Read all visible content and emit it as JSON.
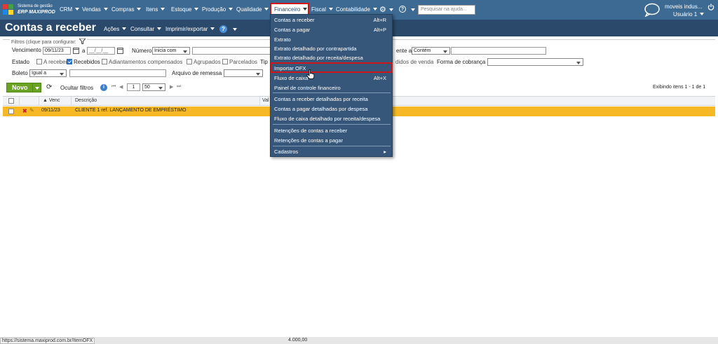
{
  "logo": {
    "line1": "Sistema de gestão",
    "line2": "ERP MAXIPROD"
  },
  "nav": {
    "items": [
      "CRM",
      "Vendas",
      "Compras",
      "Itens",
      "Estoque",
      "Produção",
      "Qualidade",
      "Financeiro",
      "Fiscal",
      "Contabilidade"
    ],
    "search_placeholder": "Pesquisar na ajuda...",
    "company": "moveis indus...",
    "user": "Usuário 1"
  },
  "titlebar": {
    "title": "Contas a receber",
    "acoes": "Ações",
    "consultar": "Consultar",
    "imprimir": "Imprimir/exportar",
    "help": "?"
  },
  "filters": {
    "legend": "Filtros (clique para configurar:",
    "vencimento_label": "Vencimento",
    "venc_from": "09/11/23",
    "venc_sep": "a",
    "venc_to": "__/__/__",
    "numero_label": "Número",
    "numero_op": "Inicia com",
    "cliente_label": "ente a",
    "cliente_op": "Contém",
    "estado_label": "Estado",
    "estados": [
      {
        "label": "A receber",
        "checked": false
      },
      {
        "label": "Recebidos",
        "checked": true
      },
      {
        "label": "Adiantamentos compensados",
        "checked": false
      },
      {
        "label": "Agrupados",
        "checked": false
      },
      {
        "label": "Parcelados",
        "checked": false
      }
    ],
    "tipo_label": "Tip",
    "pedidos_label": "didos de venda",
    "forma_label": "Forma de cobrança",
    "boleto_label": "Boleto",
    "boleto_op": "Igual a",
    "arquivo_label": "Arquivo de remessa"
  },
  "toolbar": {
    "novo": "Novo",
    "ocultar": "Ocultar filtros",
    "page": "1",
    "page_size": "50",
    "exibindo": "Exibindo itens 1 - 1 de 1"
  },
  "grid": {
    "headers": [
      "Venc",
      "Descrição",
      "Val"
    ],
    "rows": [
      {
        "venc": "09/11/23",
        "descricao": "CLIENTE 1 ref. LANÇAMENTO DE EMPRÉSTIMO"
      }
    ],
    "total": "4.000,00"
  },
  "menu": {
    "items": [
      {
        "label": "Contas a receber",
        "shortcut": "Alt+R"
      },
      {
        "label": "Contas a pagar",
        "shortcut": "Alt+P"
      },
      {
        "label": "Extrato",
        "shortcut": ""
      },
      {
        "label": "Extrato detalhado por contrapartida",
        "shortcut": ""
      },
      {
        "label": "Extrato detalhado por receita/despesa",
        "shortcut": ""
      },
      {
        "label": "Importar OFX",
        "shortcut": ""
      },
      {
        "label": "Fluxo de caixa",
        "shortcut": "Alt+X"
      },
      {
        "label": "Painel de controle financeiro",
        "shortcut": ""
      },
      {
        "label": "Contas a receber detalhadas por receita",
        "shortcut": ""
      },
      {
        "label": "Contas a pagar detalhadas por despesa",
        "shortcut": ""
      },
      {
        "label": "Fluxo de caixa detalhado por receita/despesa",
        "shortcut": ""
      },
      {
        "label": "Retenções de contas a receber",
        "shortcut": ""
      },
      {
        "label": "Retenções de contas a pagar",
        "shortcut": ""
      },
      {
        "label": "Cadastros",
        "shortcut": "▸"
      }
    ]
  },
  "status_url": "https://sistema.maxiprod.com.br/ItemOFX",
  "colors": {
    "topbar": "#3d6a93",
    "titlebar": "#2b4a6b",
    "menu": "#36577a",
    "highlight_row": "#f6b824",
    "novo": "#6aa324",
    "annotation": "#d0161b"
  }
}
